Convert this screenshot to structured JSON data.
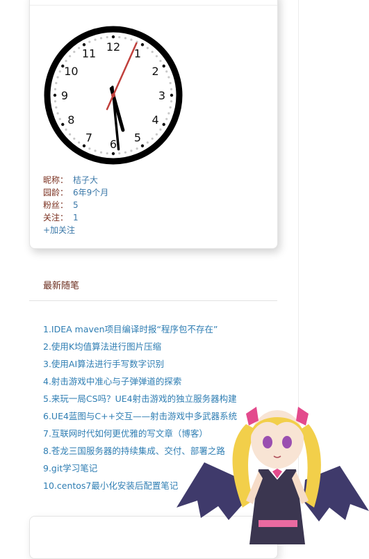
{
  "clock": {
    "numerals": [
      "12",
      "1",
      "2",
      "3",
      "4",
      "5",
      "6",
      "7",
      "8",
      "9",
      "10",
      "11"
    ],
    "time": {
      "hour": 5,
      "minute": 29,
      "second": 4
    }
  },
  "profile": {
    "nickname_label": "昵称：",
    "nickname": "桔子大",
    "age_label": "园龄：",
    "age": "6年9个月",
    "fans_label": "粉丝：",
    "fans": "5",
    "following_label": "关注：",
    "following": "1",
    "follow_button": "+加关注"
  },
  "recent": {
    "title": "最新随笔",
    "posts": [
      "1.IDEA maven项目编译时报“程序包不存在”",
      "2.使用K均值算法进行图片压缩",
      "3.使用AI算法进行手写数字识别",
      "4.射击游戏中准心与子弹弹道的探索",
      "5.来玩一局CS吗？UE4射击游戏的独立服务器构建",
      "6.UE4蓝图与C++交互——射击游戏中多武器系统",
      "7.互联网时代如何更优雅的写文章（博客）",
      "8.苍龙三国服务器的持续集成、交付、部署之路",
      "9.git学习笔记",
      "10.centos7最小化安装后配置笔记"
    ]
  },
  "colors": {
    "label": "#7a2f1e",
    "link": "#2f7eb3",
    "second_hand": "#c0403c"
  }
}
